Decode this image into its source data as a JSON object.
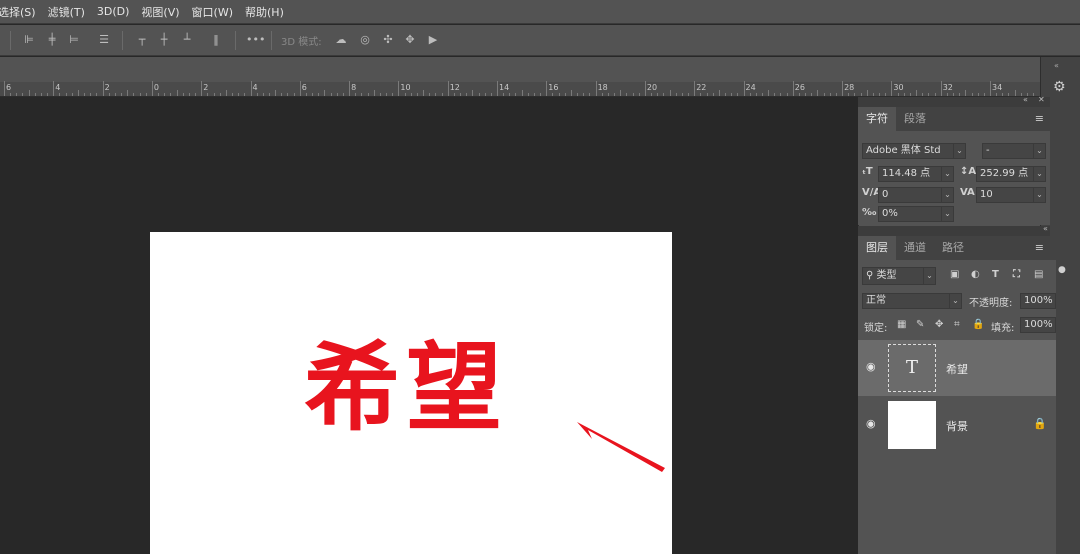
{
  "menu": [
    "选择(S)",
    "滤镜(T)",
    "3D(D)",
    "视图(V)",
    "窗口(W)",
    "帮助(H)"
  ],
  "options_bar": {
    "more_label": "•••",
    "mode_3d_label": "3D 模式:"
  },
  "ruler": {
    "labels": [
      "6",
      "4",
      "2",
      "0",
      "2",
      "4",
      "6",
      "8",
      "10",
      "12",
      "14",
      "16",
      "18",
      "20",
      "22",
      "24",
      "26",
      "28",
      "30",
      "32",
      "34"
    ]
  },
  "document": {
    "text": "希望",
    "text_color": "#e8141e",
    "background": "#ffffff"
  },
  "character_panel": {
    "tabs": [
      "字符",
      "段落"
    ],
    "active_tab": "字符",
    "font_family": "Adobe 黑体 Std",
    "font_style": "-",
    "font_size": "114.48 点",
    "leading": "252.99 点",
    "kerning": "0",
    "tracking": "10",
    "vertical_scale": "0%"
  },
  "layers_panel": {
    "tabs": [
      "图层",
      "通道",
      "路径"
    ],
    "active_tab": "图层",
    "filter_kind": "类型",
    "blend_mode": "正常",
    "opacity_label": "不透明度:",
    "opacity_value": "100%",
    "lock_label": "锁定:",
    "fill_label": "填充:",
    "fill_value": "100%",
    "layers": [
      {
        "name": "希望",
        "type": "text",
        "selected": true,
        "locked": false
      },
      {
        "name": "背景",
        "type": "background",
        "selected": false,
        "locked": true
      }
    ]
  }
}
